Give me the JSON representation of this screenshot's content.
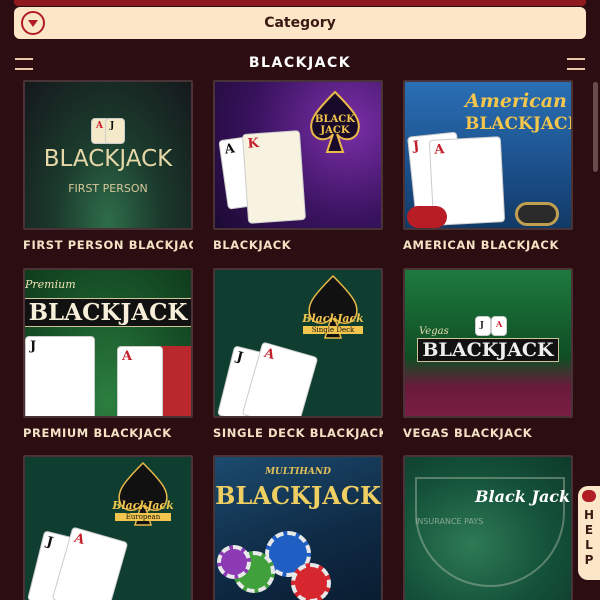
{
  "category": {
    "label": "Category",
    "icon": "chevron-down-circle-icon",
    "accent": "#b01e24"
  },
  "section": {
    "title": "BLACKJACK"
  },
  "games": [
    {
      "label": "FIRST PERSON BLACKJACK",
      "art_title": "BLACKJACK",
      "art_subtitle": "FIRST PERSON"
    },
    {
      "label": "BLACKJACK",
      "art_title": "BLACK JACK"
    },
    {
      "label": "AMERICAN BLACKJACK",
      "art_title": "American",
      "art_subtitle": "BLACKJACK"
    },
    {
      "label": "PREMIUM BLACKJACK",
      "art_title": "BLACKJACK",
      "art_subtitle": "Premium"
    },
    {
      "label": "SINGLE DECK BLACKJACK M",
      "art_title": "BlackJack",
      "art_subtitle": "Single Deck"
    },
    {
      "label": "VEGAS BLACKJACK",
      "art_title": "BLACKJACK",
      "art_subtitle": "Vegas"
    },
    {
      "label": "",
      "art_title": "BlackJack",
      "art_subtitle": "European"
    },
    {
      "label": "",
      "art_title": "BLACKJACK",
      "art_subtitle": "MULTIHAND"
    },
    {
      "label": "",
      "art_title": "Black Jack",
      "art_subtitle": "INSURANCE PAYS"
    }
  ],
  "help": {
    "letters": [
      "H",
      "E",
      "L",
      "P"
    ]
  }
}
